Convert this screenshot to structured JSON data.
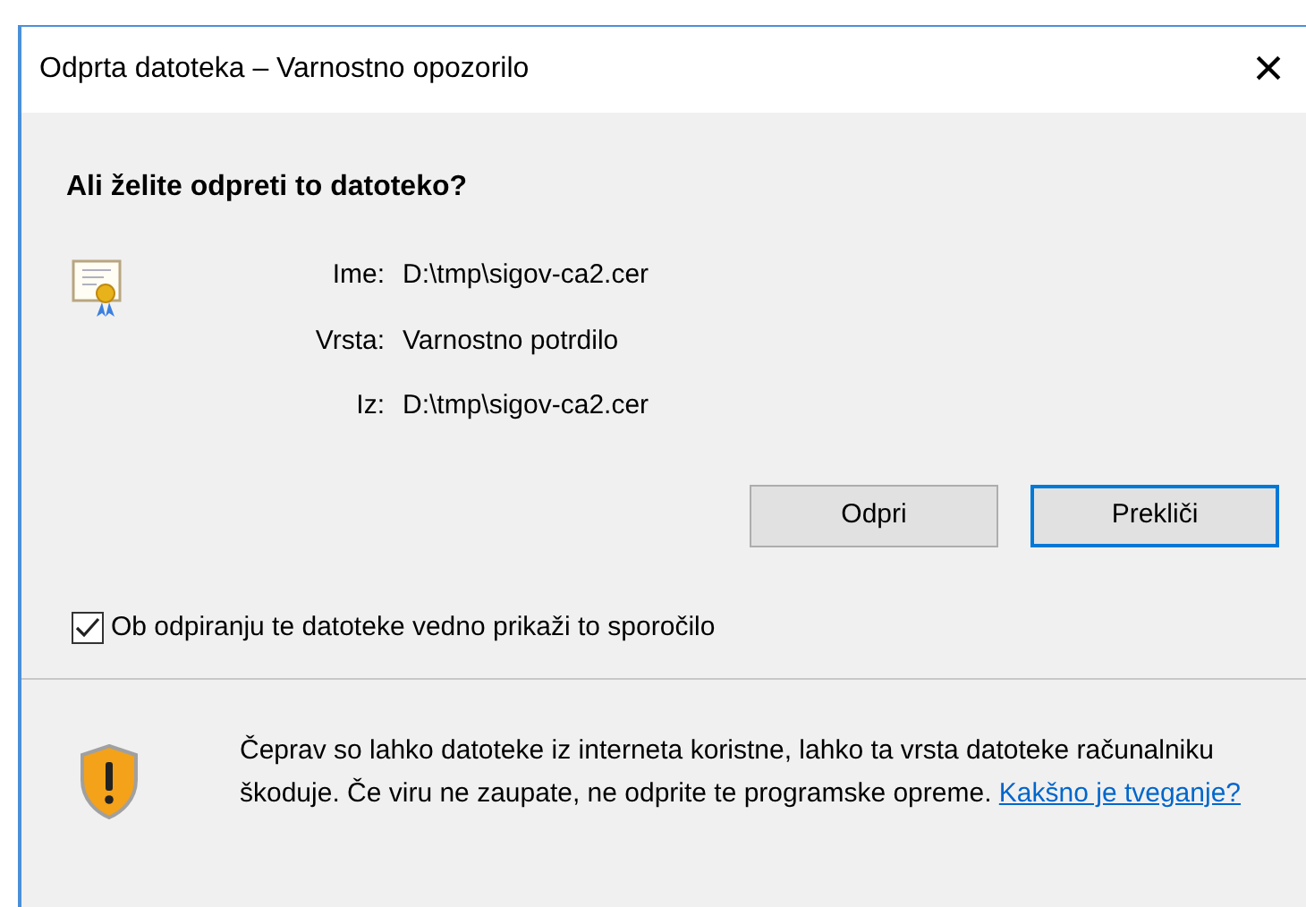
{
  "window": {
    "title": "Odprta datoteka – Varnostno opozorilo",
    "close": "×"
  },
  "question": "Ali želite odpreti to datoteko?",
  "fields": [
    {
      "label": "Ime:",
      "value": "D:\\tmp\\sigov-ca2.cer"
    },
    {
      "label": "Vrsta:",
      "value": "Varnostno potrdilo"
    },
    {
      "label": "Iz:",
      "value": "D:\\tmp\\sigov-ca2.cer"
    }
  ],
  "buttons": [
    {
      "label": "Odpri",
      "selected": false
    },
    {
      "label": "Prekliči",
      "selected": true
    }
  ],
  "checkbox": {
    "label": "Ob odpiranju te datoteke vedno prikaži to sporočilo",
    "checked": true
  },
  "warning": {
    "text": "Čeprav so lahko datoteke iz interneta koristne, lahko ta vrsta datoteke računalniku škoduje. Če viru ne zaupate, ne odprite te programske opreme.",
    "link": "Kakšno je tveganje?"
  }
}
